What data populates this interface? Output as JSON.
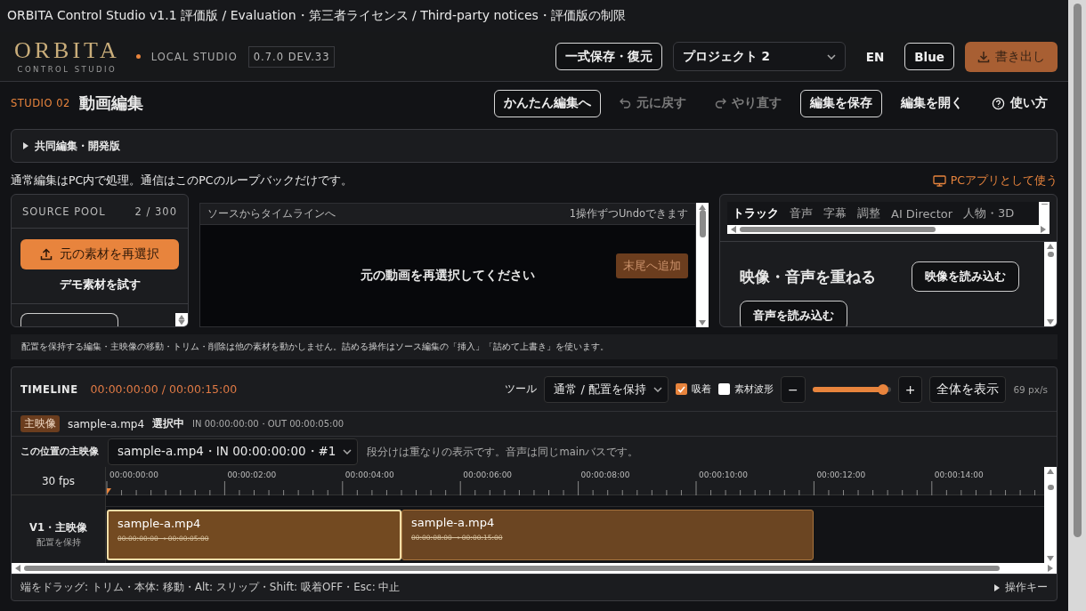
{
  "window": {
    "title": "ORBITA Control Studio v1.1 評価版 / Evaluation・第三者ライセンス / Third-party notices・評価版の制限"
  },
  "header": {
    "logo": "ORBITA",
    "logo_sub": "CONTROL STUDIO",
    "badge": "LOCAL STUDIO",
    "version": "0.7.0 DEV.33",
    "actions": [
      {
        "kind": "outline",
        "label": "一式保存・復元",
        "disabled": false
      },
      {
        "kind": "select",
        "label": "プロジェクト 2",
        "disabled": false
      },
      {
        "kind": "plain",
        "label": "EN",
        "disabled": false
      },
      {
        "kind": "outline",
        "label": "Blue",
        "disabled": false
      },
      {
        "kind": "export",
        "label": "書き出し",
        "disabled": true
      }
    ]
  },
  "studio": {
    "eyebrow": "STUDIO 02",
    "title": "動画編集",
    "actions": [
      {
        "kind": "outline",
        "label": "かんたん編集へ",
        "disabled": false
      },
      {
        "kind": "undo",
        "label": "元に戻す",
        "disabled": true
      },
      {
        "kind": "redo",
        "label": "やり直す",
        "disabled": true
      },
      {
        "kind": "outline",
        "label": "編集を保存",
        "disabled": false
      },
      {
        "kind": "plain",
        "label": "編集を開く",
        "disabled": false
      },
      {
        "kind": "help",
        "label": "使い方",
        "disabled": false
      }
    ]
  },
  "collab": {
    "label": "共同編集・開発版",
    "expanded": false
  },
  "notice": {
    "text": "通常編集はPC内で処理。通信はこのPCのループバックだけです。",
    "link": "PCアプリとして使う"
  },
  "source_pool": {
    "title": "SOURCE POOL",
    "count": "2 / 300",
    "primary": "元の素材を再選択",
    "secondary": "デモ素材を試す"
  },
  "preview": {
    "title": "ソースからタイムラインへ",
    "hint": "1操作ずつUndoできます",
    "message": "元の動画を再選択してください",
    "add": {
      "label": "末尾へ追加",
      "disabled": true
    }
  },
  "inspector": {
    "tabs": [
      {
        "label": "トラック",
        "selected": true
      },
      {
        "label": "音声",
        "selected": false
      },
      {
        "label": "字幕",
        "selected": false
      },
      {
        "label": "調整",
        "selected": false
      },
      {
        "label": "AI Director",
        "selected": false
      },
      {
        "label": "人物・3D",
        "selected": false
      }
    ],
    "heading": "映像・音声を重ねる",
    "buttons": [
      "映像を読み込む",
      "音声を読み込む"
    ]
  },
  "info": "配置を保持する編集・主映像の移動・トリム・削除は他の素材を動かしません。詰める操作はソース編集の「挿入」「詰めて上書き」を使います。",
  "timeline": {
    "title": "TIMELINE",
    "time": "00:00:00:00 / 00:00:15:00",
    "tool_label": "ツール",
    "tool": "通常 / 配置を保持",
    "options": [
      {
        "label": "吸着",
        "checked": true
      },
      {
        "label": "素材波形",
        "checked": false
      }
    ],
    "zoom_out": "−",
    "zoom": {
      "level": 0.9
    },
    "zoom_in": "+",
    "fit": "全体を表示",
    "scale": "69 px/s",
    "selection": {
      "tag": "主映像",
      "file": "sample-a.mp4",
      "state": "選択中",
      "range": "IN 00:00:00:00・OUT 00:00:05:00"
    },
    "main_label": "この位置の主映像",
    "main_select": "sample-a.mp4・IN 00:00:00:00・#1",
    "main_hint": "段分けは重なりの表示です。音声は同じmainバスです。",
    "fps": "30 fps",
    "ticks": [
      "00:00:00:00",
      "00:00:02:00",
      "00:00:04:00",
      "00:00:06:00",
      "00:00:08:00",
      "00:00:10:00",
      "00:00:12:00",
      "00:00:14:00"
    ],
    "track": {
      "name": "V1・主映像",
      "mode": "配置を保持",
      "clips": [
        {
          "name": "sample-a.mp4",
          "range": "00:00:00:00 → 00:00:05:00",
          "selected": true
        },
        {
          "name": "sample-a.mp4",
          "range": "00:00:08:00 → 00:00:15:00",
          "selected": false
        }
      ]
    },
    "footer": "端をドラッグ: トリム・本体: 移動・Alt: スリップ・Shift: 吸着OFF・Esc: 中止",
    "keys": "操作キー"
  }
}
